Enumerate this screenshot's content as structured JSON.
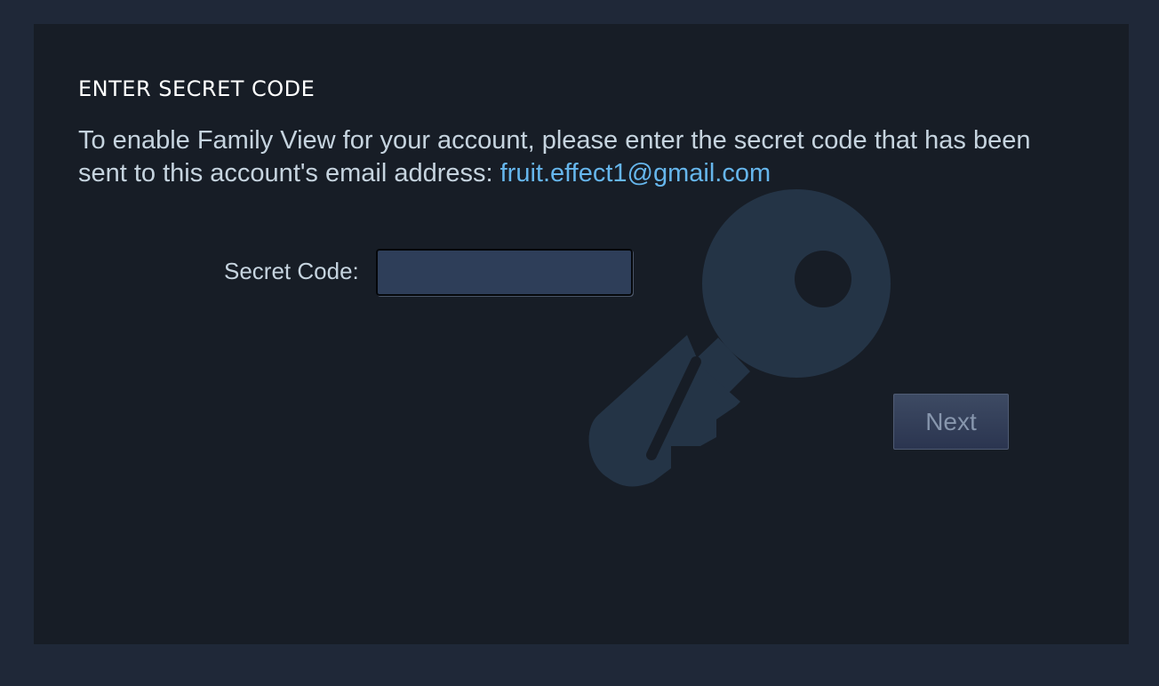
{
  "dialog": {
    "title": "ENTER SECRET CODE",
    "description_prefix": "To enable Family View for your account, please enter the secret code that has been sent to this account's email address: ",
    "email": "fruit.effect1@gmail.com",
    "secret_code_label": "Secret Code:",
    "secret_code_value": "",
    "next_label": "Next",
    "watermark_icon": "key-icon"
  },
  "colors": {
    "page_background": "#1f2838",
    "panel_background": "#171d26",
    "link": "#66b6ec",
    "text": "#c6d4df",
    "input_background": "#2e3e59"
  }
}
